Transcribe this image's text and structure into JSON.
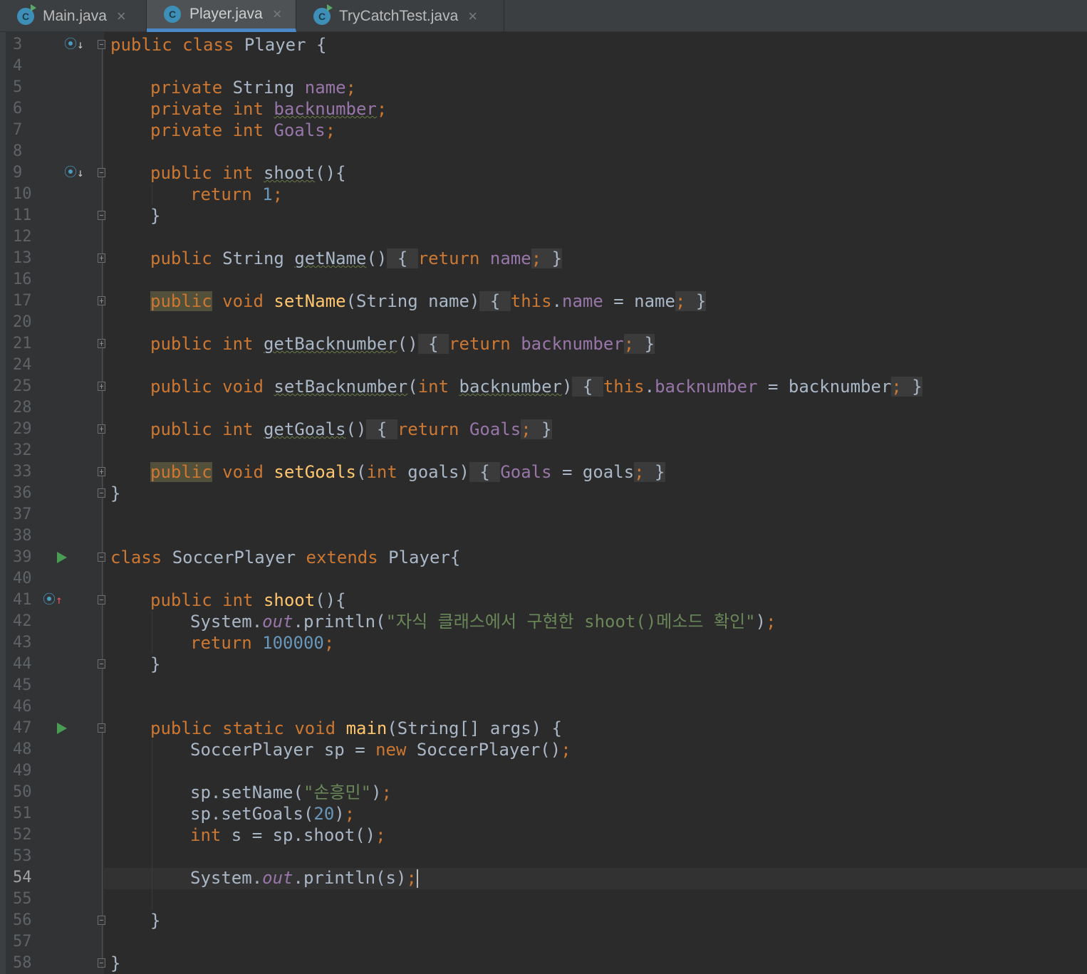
{
  "tabs": [
    {
      "label": "Main.java",
      "icon": "class-run-icon"
    },
    {
      "label": "Player.java",
      "icon": "class-icon",
      "active": true
    },
    {
      "label": "TryCatchTest.java",
      "icon": "class-run-icon"
    }
  ],
  "editor": {
    "current_line": "54",
    "lines": {
      "l3": "3",
      "l4": "4",
      "l5": "5",
      "l6": "6",
      "l7": "7",
      "l8": "8",
      "l9": "9",
      "l10": "10",
      "l11": "11",
      "l12": "12",
      "l13": "13",
      "l16": "16",
      "l17": "17",
      "l20": "20",
      "l21": "21",
      "l24": "24",
      "l25": "25",
      "l28": "28",
      "l29": "29",
      "l32": "32",
      "l33": "33",
      "l36": "36",
      "l37": "37",
      "l38": "38",
      "l39": "39",
      "l40": "40",
      "l41": "41",
      "l42": "42",
      "l43": "43",
      "l44": "44",
      "l45": "45",
      "l46": "46",
      "l47": "47",
      "l48": "48",
      "l49": "49",
      "l50": "50",
      "l51": "51",
      "l52": "52",
      "l53": "53",
      "l54": "54",
      "l55": "55",
      "l56": "56",
      "l57": "57",
      "l58": "58"
    },
    "code": {
      "l3": [
        "public ",
        "class ",
        "Player {"
      ],
      "l5": [
        "private ",
        "String ",
        "name",
        ";"
      ],
      "l6": [
        "private ",
        "int ",
        "backnumber",
        ";"
      ],
      "l7": [
        "private ",
        "int ",
        "Goals",
        ";"
      ],
      "l9": [
        "public ",
        "int ",
        "shoot",
        "(){"
      ],
      "l10": [
        "return ",
        "1",
        ";"
      ],
      "l11": [
        "}"
      ],
      "l13": [
        "public ",
        "String ",
        "getName",
        "()",
        " { ",
        "return ",
        "name",
        ";",
        " }"
      ],
      "l17": [
        "public",
        " void ",
        "setName",
        "(String name)",
        " { ",
        "this",
        ".",
        "name",
        " = name",
        ";",
        " }"
      ],
      "l21": [
        "public ",
        "int ",
        "getBacknumber",
        "()",
        " { ",
        "return ",
        "backnumber",
        ";",
        " }"
      ],
      "l25": [
        "public ",
        "void ",
        "setBacknumber",
        "(",
        "int ",
        "backnumber",
        ")",
        " { ",
        "this",
        ".",
        "backnumber",
        " = backnumber",
        ";",
        " }"
      ],
      "l29": [
        "public ",
        "int ",
        "getGoals",
        "()",
        " { ",
        "return ",
        "Goals",
        ";",
        " }"
      ],
      "l33": [
        "public",
        " void ",
        "setGoals",
        "(",
        "int ",
        "goals)",
        " { ",
        "Goals",
        " = goals",
        ";",
        " }"
      ],
      "l36": [
        "}"
      ],
      "l39": [
        "class ",
        "SoccerPlayer ",
        "extends ",
        "Player{"
      ],
      "l41": [
        "public ",
        "int ",
        "shoot",
        "(){"
      ],
      "l42": [
        "System.",
        "out",
        ".println(",
        "\"자식 클래스에서 구현한 shoot()메소드 확인\"",
        ")",
        ";"
      ],
      "l43": [
        "return ",
        "100000",
        ";"
      ],
      "l44": [
        "}"
      ],
      "l47": [
        "public ",
        "static ",
        "void ",
        "main",
        "(String[] args) {"
      ],
      "l48": [
        "SoccerPlayer sp = ",
        "new ",
        "SoccerPlayer()",
        ";"
      ],
      "l50": [
        "sp.setName(",
        "\"손흥민\"",
        ")",
        ";"
      ],
      "l51": [
        "sp.setGoals(",
        "20",
        ")",
        ";"
      ],
      "l52": [
        "int ",
        "s = sp.shoot()",
        ";"
      ],
      "l54": [
        "System.",
        "out",
        ".println(s)",
        ";"
      ],
      "l56": [
        "}"
      ],
      "l58": [
        "}"
      ]
    }
  },
  "colors": {
    "background": "#2b2b2b",
    "gutter": "#313335",
    "keyword": "#cc7832",
    "field": "#9876aa",
    "number": "#6897bb",
    "string": "#6a8759",
    "method_decl": "#ffc66d",
    "default_text": "#a9b7c6",
    "active_tab_underline": "#4a88c7"
  }
}
